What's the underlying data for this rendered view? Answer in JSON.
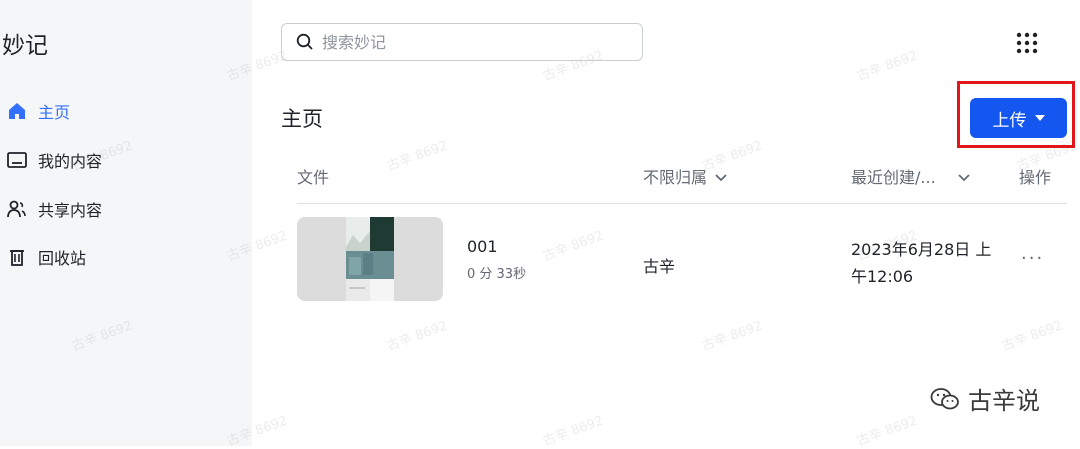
{
  "app": {
    "title": "妙记"
  },
  "sidebar": {
    "items": [
      {
        "label": "主页",
        "icon": "home-icon",
        "active": true
      },
      {
        "label": "我的内容",
        "icon": "folder-icon",
        "active": false
      },
      {
        "label": "共享内容",
        "icon": "users-icon",
        "active": false
      },
      {
        "label": "回收站",
        "icon": "trash-icon",
        "active": false
      }
    ]
  },
  "search": {
    "placeholder": "搜索妙记",
    "value": ""
  },
  "header": {
    "title": "主页",
    "upload_label": "上传"
  },
  "table": {
    "columns": {
      "file": "文件",
      "owner": "不限归属",
      "created": "最近创建/...",
      "actions": "操作"
    },
    "rows": [
      {
        "name": "001",
        "duration": "0 分 33秒",
        "owner": "古辛",
        "created": "2023年6月28日 上午12:06",
        "more": "···"
      }
    ]
  },
  "watermark": {
    "text": "古辛 8692"
  },
  "brand": {
    "text": "古辛说"
  },
  "colors": {
    "accent": "#1456f0",
    "active_nav": "#3370ff",
    "highlight": "#e0161b",
    "sidebar_bg": "#f5f6f7"
  }
}
